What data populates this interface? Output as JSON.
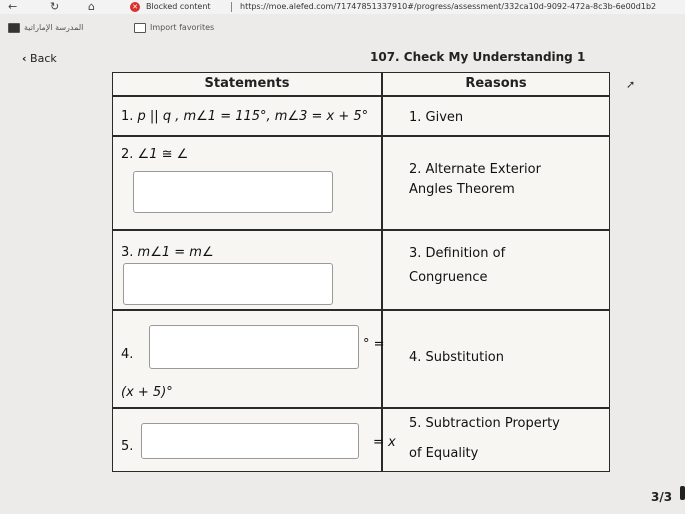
{
  "browser": {
    "blocked_label": "Blocked content",
    "url": "https://moe.alefed.com/71747851337910#/progress/assessment/332ca10d-9092-472a-8c3b-6e00d1b2"
  },
  "bookmarks": [
    {
      "label": "المدرسة الإماراتية"
    },
    {
      "label": "Import favorites"
    }
  ],
  "header": {
    "back_label": "Back",
    "title": "107. Check My Understanding 1"
  },
  "table": {
    "col_statements": "Statements",
    "col_reasons": "Reasons",
    "rows": [
      {
        "num": "1.",
        "statement": "p || q , m∠1 = 115°, m∠3 = x + 5°",
        "reason": "1. Given"
      },
      {
        "num": "2.",
        "statement": "∠1 ≅ ∠",
        "reason_line1": "2. Alternate Exterior",
        "reason_line2": "Angles Theorem"
      },
      {
        "num": "3.",
        "statement": "m∠1 = m∠",
        "reason_line1": "3. Definition of",
        "reason_line2": "Congruence"
      },
      {
        "num": "4.",
        "statement_suffix": "° =",
        "statement_line2": "(x + 5)°",
        "reason": "4. Substitution"
      },
      {
        "num": "5.",
        "statement_suffix": "= x",
        "reason_line1": "5. Subtraction Property",
        "reason_line2": "of Equality"
      }
    ]
  },
  "pagination": "3/3"
}
